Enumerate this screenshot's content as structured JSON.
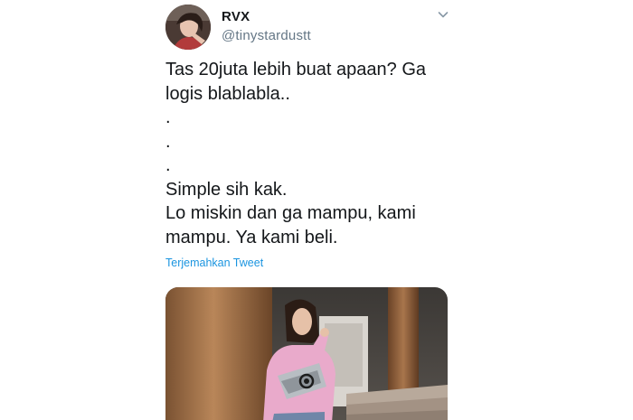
{
  "tweet": {
    "display_name": "RVX",
    "handle": "@tinystardustt",
    "text_lines": [
      "Tas 20juta lebih buat apaan? Ga",
      "logis blablabla..",
      ".",
      ".",
      ".",
      "Simple sih kak.",
      "Lo miskin dan ga mampu, kami",
      "mampu. Ya kami beli."
    ],
    "translate_label": "Terjemahkan Tweet",
    "more_icon": "chevron-down-icon"
  },
  "colors": {
    "text": "#14171a",
    "secondary": "#657786",
    "link": "#1b95e0"
  }
}
